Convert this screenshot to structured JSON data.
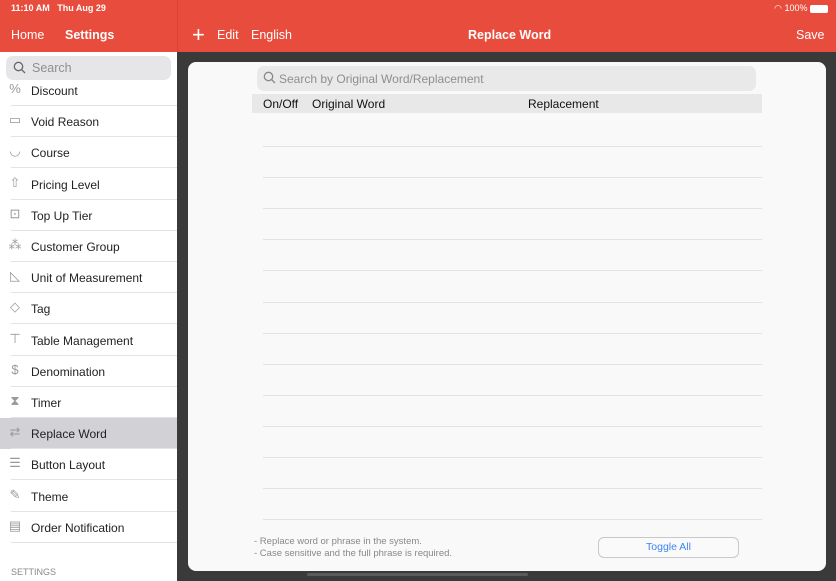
{
  "status": {
    "time": "11:10 AM",
    "date": "Thu Aug 29",
    "battery": "100%"
  },
  "nav": {
    "home": "Home",
    "settings": "Settings",
    "add_icon": "plus-icon",
    "edit": "Edit",
    "language": "English",
    "title": "Replace Word",
    "save": "Save"
  },
  "sidebar": {
    "search_placeholder": "Search",
    "items": [
      {
        "label": "Discount",
        "icon": "percent-badge-icon"
      },
      {
        "label": "Void Reason",
        "icon": "void-ticket-icon"
      },
      {
        "label": "Course",
        "icon": "dish-icon"
      },
      {
        "label": "Pricing Level",
        "icon": "price-arrow-icon"
      },
      {
        "label": "Top Up Tier",
        "icon": "top-up-icon"
      },
      {
        "label": "Customer Group",
        "icon": "group-icon"
      },
      {
        "label": "Unit of Measurement",
        "icon": "ruler-triangle-icon"
      },
      {
        "label": "Tag",
        "icon": "tag-icon"
      },
      {
        "label": "Table Management",
        "icon": "table-icon"
      },
      {
        "label": "Denomination",
        "icon": "money-bag-icon"
      },
      {
        "label": "Timer",
        "icon": "hourglass-icon"
      },
      {
        "label": "Replace Word",
        "icon": "replace-text-icon",
        "selected": true
      },
      {
        "label": "Button Layout",
        "icon": "list-layout-icon"
      },
      {
        "label": "Theme",
        "icon": "brush-icon"
      },
      {
        "label": "Order Notification",
        "icon": "order-notification-icon"
      }
    ],
    "section_header": "SETTINGS"
  },
  "main": {
    "search_placeholder": "Search by Original Word/Replacement",
    "columns": [
      "On/Off",
      "Original Word",
      "Replacement"
    ],
    "notes": [
      "- Replace word or phrase in the system.",
      "- Case sensitive and the full phrase is required."
    ],
    "toggle_all": "Toggle All"
  },
  "colors": {
    "accent": "#e84c3d",
    "link": "#3d85f0",
    "selected_row": "#d1d1d6"
  }
}
